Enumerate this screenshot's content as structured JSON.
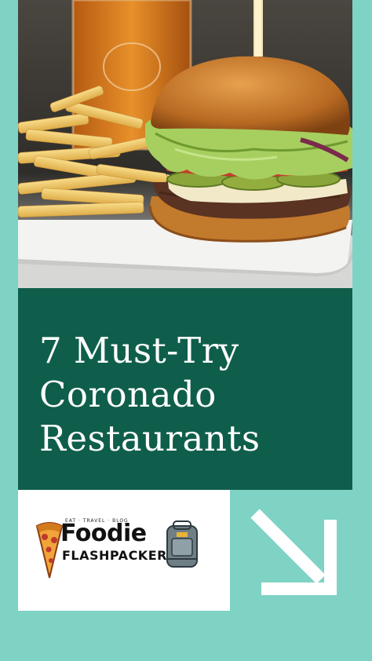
{
  "title": {
    "line1": "7 Must-Try",
    "line2": "Coronado",
    "line3": "Restaurants"
  },
  "logo": {
    "tagline": "EAT · TRAVEL · BLOG",
    "name_top": "Foodie",
    "name_bottom": "FLASHPACKER"
  },
  "colors": {
    "background": "#7fd3c4",
    "title_panel": "#0f5e4b",
    "arrow": "#ffffff"
  },
  "icons": {
    "arrow": "arrow-down-right-icon",
    "pizza": "pizza-slice-icon",
    "backpack": "backpack-icon"
  }
}
